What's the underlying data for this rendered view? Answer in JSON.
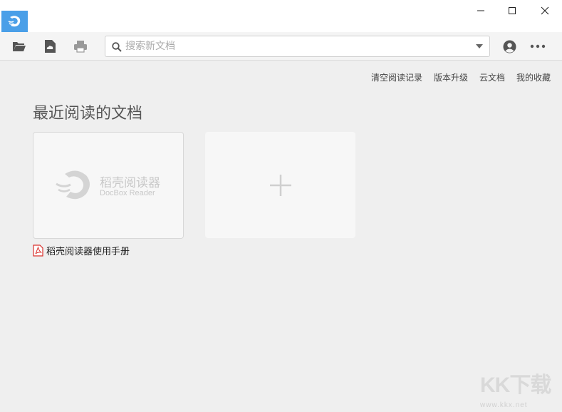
{
  "window": {
    "minimize_symbol": "—",
    "maximize_symbol": "☐",
    "close_symbol": "✕"
  },
  "toolbar": {
    "icons": [
      "folder-open-icon",
      "cloud-document-icon",
      "print-icon",
      "user-account-icon",
      "more-icon"
    ],
    "search": {
      "placeholder": "搜索新文档",
      "value": ""
    }
  },
  "links": [
    "清空阅读记录",
    "版本升级",
    "云文档",
    "我的收藏"
  ],
  "main": {
    "section_title": "最近阅读的文档",
    "recent_docs": [
      {
        "thumbnail_title": "稻壳阅读器",
        "thumbnail_subtitle": "DocBox Reader",
        "name": "稻壳阅读器使用手册",
        "file_icon": "pdf-icon"
      }
    ],
    "add_icon": "plus-icon"
  },
  "watermark": {
    "text": "KK下载",
    "site": "www.kkx.net"
  },
  "colors": {
    "accent": "#4a9fe8",
    "pdf_red": "#d9302c",
    "background": "#efefef"
  }
}
